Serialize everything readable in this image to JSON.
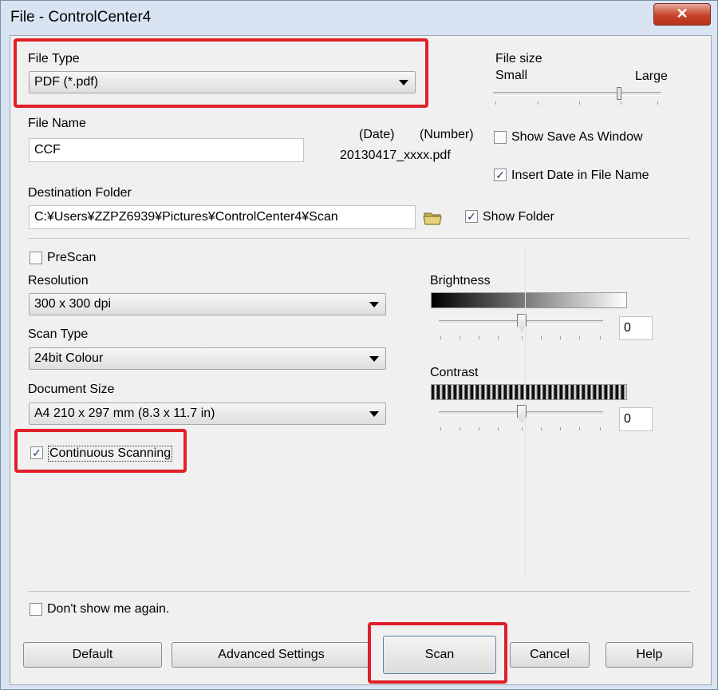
{
  "window": {
    "title": "File - ControlCenter4",
    "close_glyph": "✕"
  },
  "file_type": {
    "label": "File Type",
    "selected": "PDF (*.pdf)"
  },
  "file_size": {
    "label": "File size",
    "small": "Small",
    "large": "Large",
    "level": 0.76
  },
  "file_name": {
    "label": "File Name",
    "value": "CCF",
    "date_label": "(Date)",
    "number_label": "(Number)",
    "preview": "20130417_xxxx.pdf"
  },
  "options": {
    "show_save_as": {
      "label": "Show Save As Window",
      "checked": false
    },
    "insert_date": {
      "label": "Insert Date in File Name",
      "checked": true
    },
    "show_folder": {
      "label": "Show Folder",
      "checked": true
    }
  },
  "destination": {
    "label": "Destination Folder",
    "value": "C:¥Users¥ZZPZ6939¥Pictures¥ControlCenter4¥Scan",
    "icon": "folder-icon"
  },
  "prescan": {
    "label": "PreScan",
    "checked": false
  },
  "resolution": {
    "label": "Resolution",
    "selected": "300 x 300 dpi"
  },
  "scan_type": {
    "label": "Scan Type",
    "selected": "24bit Colour"
  },
  "document_size": {
    "label": "Document Size",
    "selected": "A4 210 x 297 mm (8.3 x 11.7 in)"
  },
  "continuous": {
    "label": "Continuous Scanning",
    "checked": true
  },
  "brightness": {
    "label": "Brightness",
    "value": "0"
  },
  "contrast": {
    "label": "Contrast",
    "value": "0"
  },
  "dont_show": {
    "label": "Don't show me again.",
    "checked": false
  },
  "buttons": {
    "default": "Default",
    "advanced": "Advanced Settings",
    "scan": "Scan",
    "cancel": "Cancel",
    "help": "Help"
  },
  "colors": {
    "highlight": "#e0202a",
    "title_bar": "#d8e4f2",
    "close": "#c7422a"
  }
}
